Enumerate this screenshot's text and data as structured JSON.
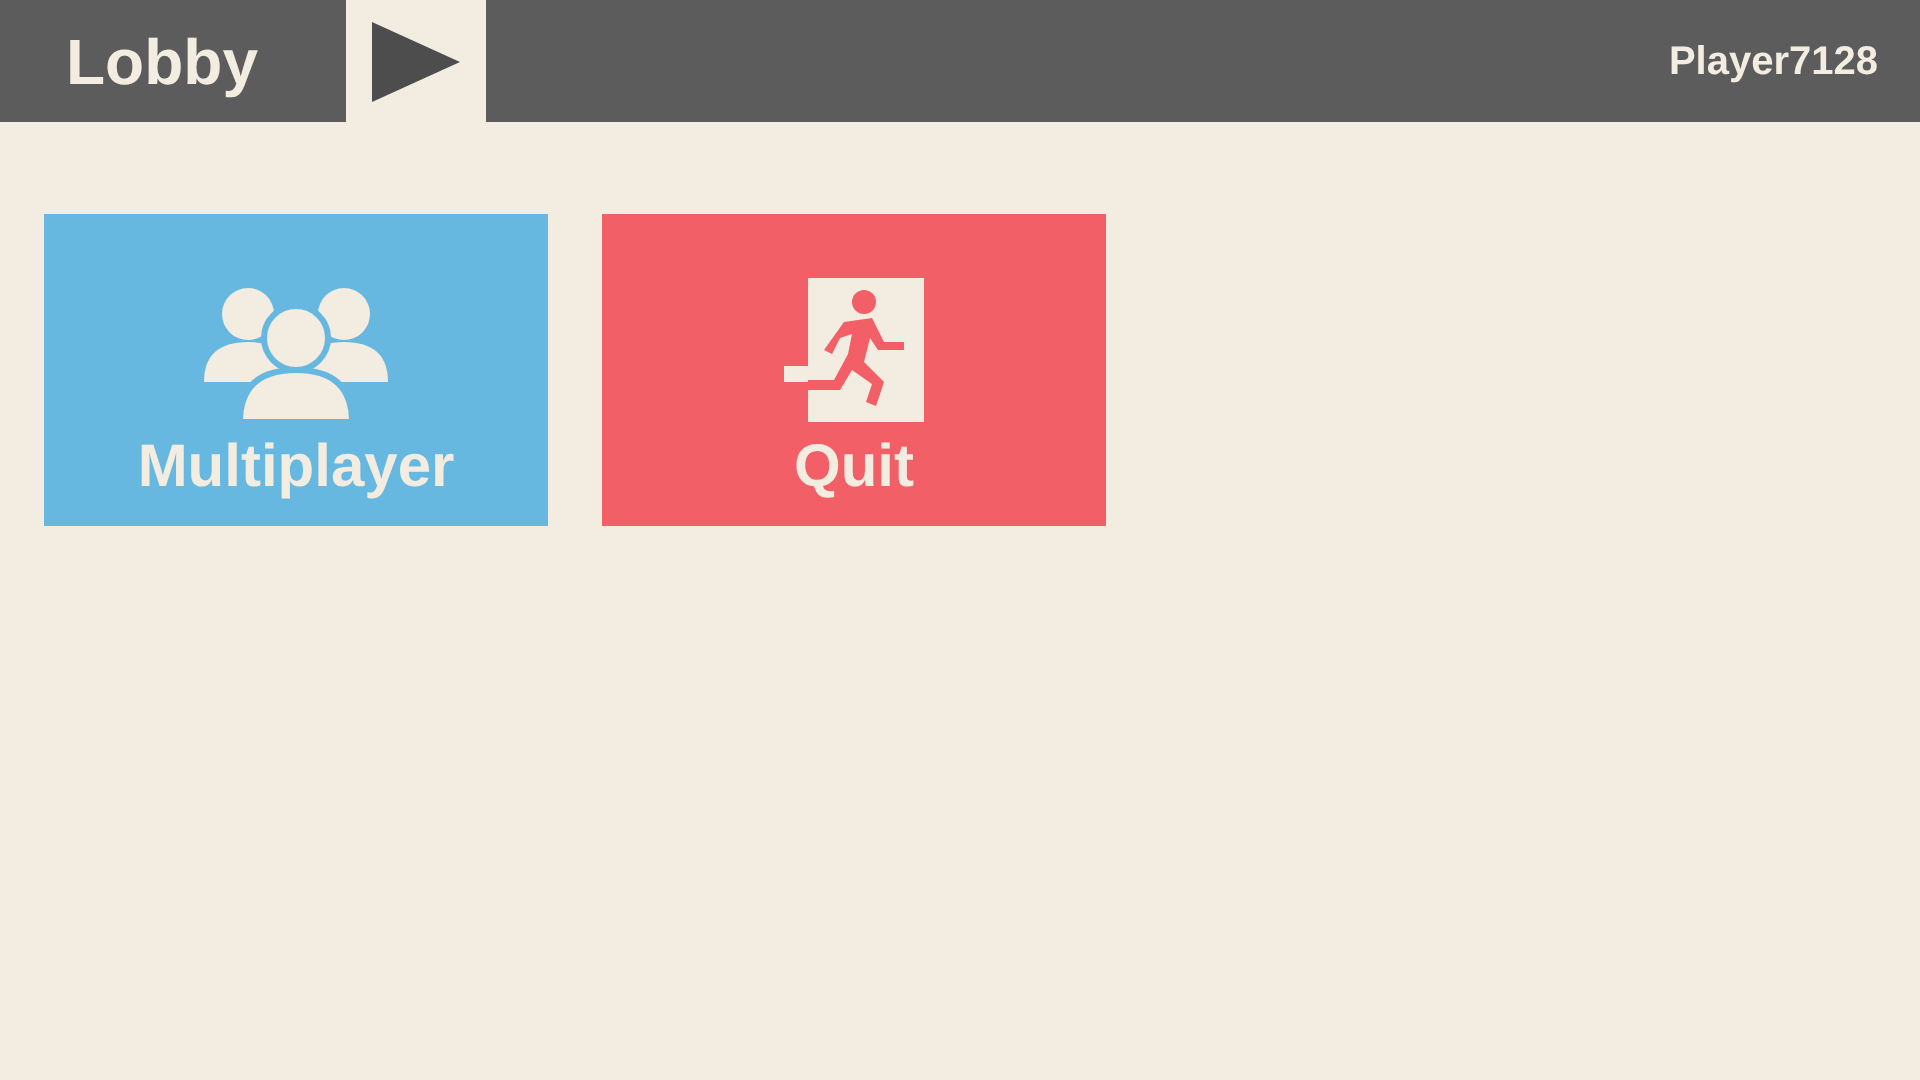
{
  "header": {
    "title": "Lobby",
    "player": "Player7128"
  },
  "tiles": [
    {
      "kind": "multiplayer",
      "label": "Multiplayer",
      "color": "#67b8e0"
    },
    {
      "kind": "quit",
      "label": "Quit",
      "color": "#f25f66"
    }
  ]
}
